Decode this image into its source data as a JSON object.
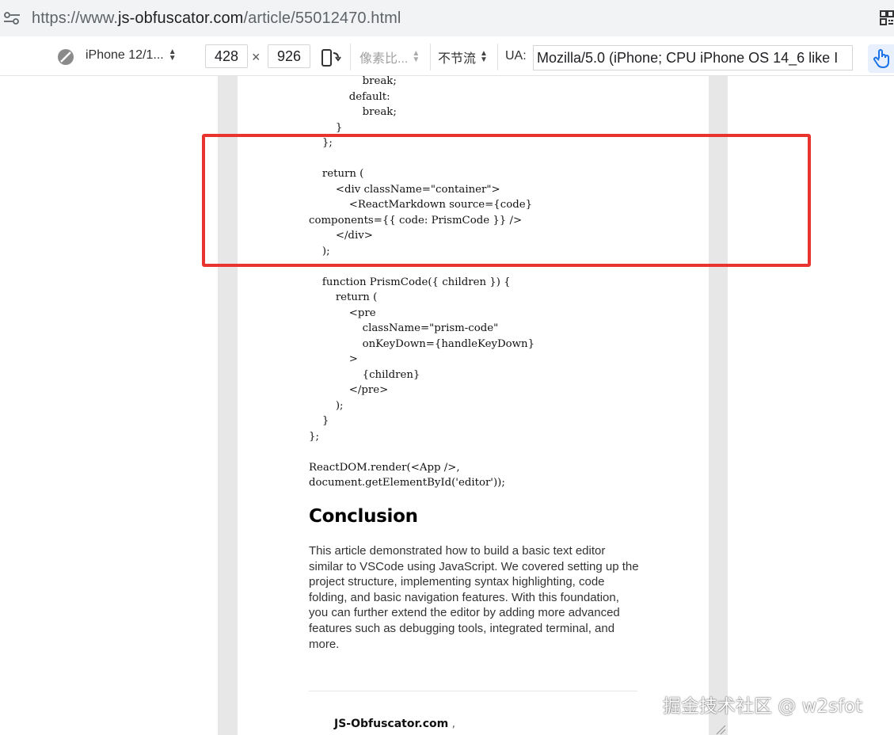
{
  "address_bar": {
    "url_prefix": "https://www.",
    "url_domain": "js-obfuscator.com",
    "url_path": "/article/55012470.html"
  },
  "device_toolbar": {
    "device_name": "iPhone 12/1...",
    "width": "428",
    "times": "×",
    "height": "926",
    "dpr_label": "像素比...",
    "throttle_label": "不节流",
    "ua_label": "UA:",
    "ua_value": "Mozilla/5.0 (iPhone; CPU iPhone OS 14_6 like I"
  },
  "article": {
    "code_lines": [
      "                break;",
      "            default:",
      "                break;",
      "        }",
      "    };",
      "",
      "    return (",
      "        <div className=\"container\">",
      "            <ReactMarkdown source={code}",
      "components={{ code: PrismCode }} />",
      "        </div>",
      "    );",
      "",
      "    function PrismCode({ children }) {",
      "        return (",
      "            <pre",
      "                className=\"prism-code\"",
      "                onKeyDown={handleKeyDown}",
      "            >",
      "                {children}",
      "            </pre>",
      "        );",
      "    }",
      "};",
      "",
      "ReactDOM.render(<App />,",
      "document.getElementById('editor'));"
    ],
    "conclusion_title": "Conclusion",
    "conclusion_body": "This article demonstrated how to build a basic text editor similar to VSCode using JavaScript. We covered setting up the project structure, implementing syntax highlighting, code folding, and basic navigation features. With this foundation, you can further extend the editor by adding more advanced features such as debugging tools, integrated terminal, and more.",
    "site_name": "JS-Obfuscator.com",
    "site_comma": " ,"
  },
  "watermark": "掘金技术社区 @ w2sfot",
  "colors": {
    "highlight": "#e8332f",
    "toolbar_bg": "#f1f3f4",
    "touch_active": "#1a73e8"
  },
  "icons": {
    "tune": "tune-icon",
    "qr": "qr-code-icon",
    "no_throttle": "no-throttle-icon",
    "rotate": "rotate-icon",
    "touch": "touch-icon",
    "resize": "resize-handle-icon"
  }
}
